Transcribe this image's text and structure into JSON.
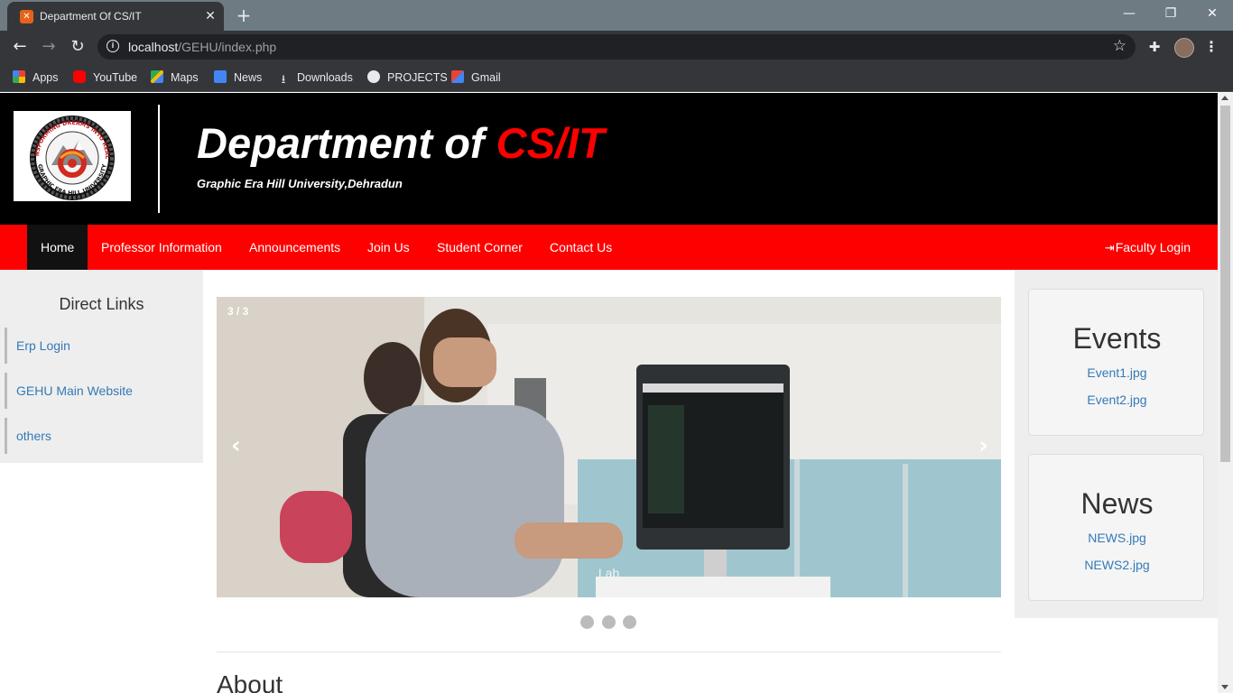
{
  "browser": {
    "tab_title": "Department Of CS/IT",
    "tab_favicon": "xampp-icon",
    "url_host": "localhost",
    "url_path": "/GEHU/index.php",
    "bookmarks": [
      {
        "label": "Apps",
        "icon": "apps-grid-icon"
      },
      {
        "label": "YouTube",
        "icon": "youtube-icon"
      },
      {
        "label": "Maps",
        "icon": "maps-icon"
      },
      {
        "label": "News",
        "icon": "news-icon"
      },
      {
        "label": "Downloads",
        "icon": "download-icon"
      },
      {
        "label": "PROJECTS",
        "icon": "globe-icon"
      },
      {
        "label": "Gmail",
        "icon": "gmail-icon"
      }
    ]
  },
  "header": {
    "title_prefix": "Department of ",
    "title_accent": "CS/IT",
    "subtitle": "Graphic Era Hill University,Dehradun",
    "logo_text_top": "TRANSFORMING DREAMS INTO REALITY",
    "logo_text_bottom": "GRAPHIC ERA HILL UNIVERSITY"
  },
  "nav": {
    "items": [
      "Home",
      "Professor Information",
      "Announcements",
      "Join Us",
      "Student Corner",
      "Contact Us"
    ],
    "active": "Home",
    "login_label": "Faculty Login"
  },
  "direct_links": {
    "title": "Direct Links",
    "items": [
      "Erp Login",
      "GEHU Main Website",
      "others"
    ]
  },
  "slider": {
    "counter": "3 / 3",
    "caption": "Lab",
    "prev": "‹",
    "next": "›",
    "slide_count": 3
  },
  "about": {
    "heading": "About"
  },
  "sidebar": {
    "events": {
      "title": "Events",
      "items": [
        "Event1.jpg",
        "Event2.jpg"
      ]
    },
    "news": {
      "title": "News",
      "items": [
        "NEWS.jpg",
        "NEWS2.jpg"
      ]
    }
  },
  "colors": {
    "accent_red": "#ff0000",
    "header_black": "#000000",
    "link_blue": "#337ab7",
    "panel_gray": "#eeeeee"
  }
}
